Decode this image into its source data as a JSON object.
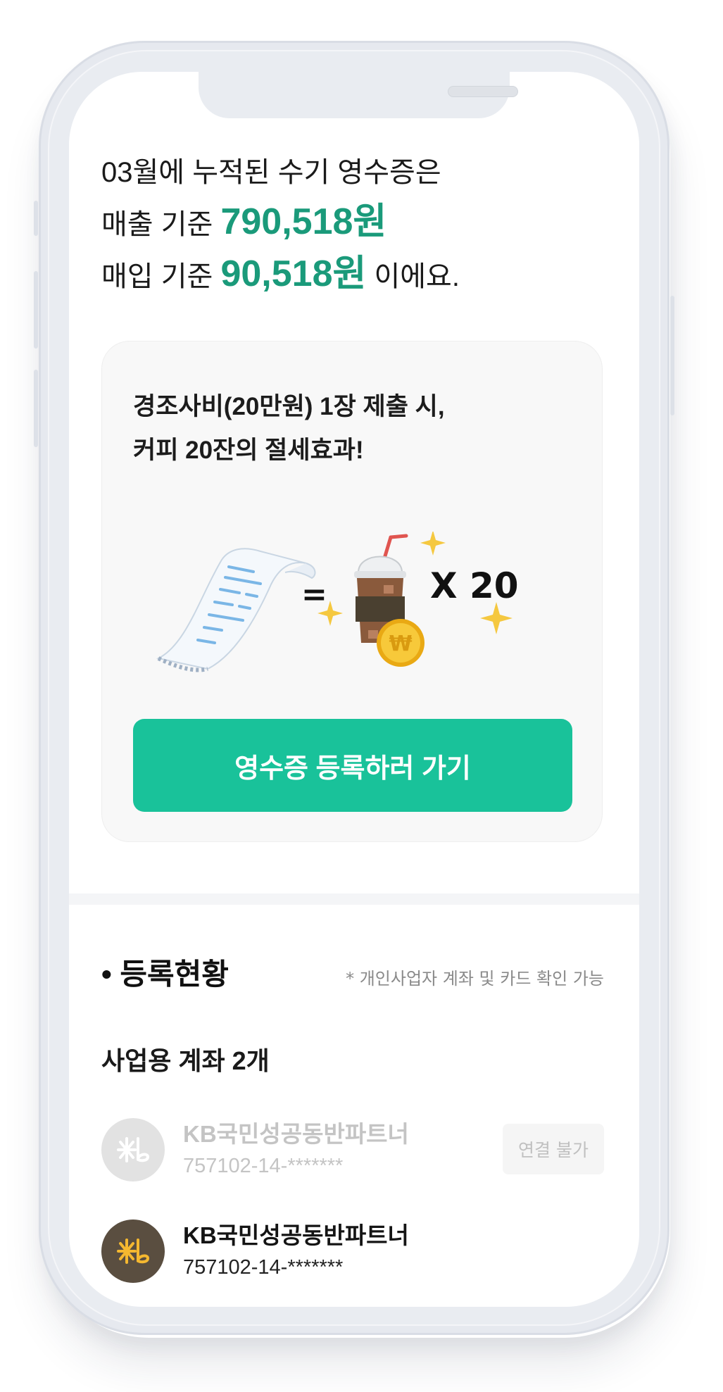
{
  "summary": {
    "line1": "03월에 누적된 수기 영수증은",
    "sales_prefix": "매출 기준 ",
    "sales_amount": "790,518원",
    "purchase_prefix": "매입 기준 ",
    "purchase_amount": "90,518원",
    "purchase_suffix": " 이에요."
  },
  "promo_card": {
    "text_line1": "경조사비(20만원) 1장 제출 시,",
    "text_line2": "커피 20잔의 절세효과!",
    "equals": "=",
    "multiplier": "X  20",
    "icons": [
      "receipt-icon",
      "iced-coffee-icon",
      "won-coin-icon",
      "sparkle-icon"
    ],
    "cta_label": "영수증 등록하러 가기",
    "cta_color": "#19c29a"
  },
  "registration": {
    "title": "• 등록현황",
    "note": "* 개인사업자 계좌 및 카드 확인 가능",
    "accounts_heading": "사업용 계좌 2개",
    "accounts": [
      {
        "bank": "KB국민성공동반파트너",
        "number": "757102-14-*******",
        "status": "연결 불가",
        "disabled": true
      },
      {
        "bank": "KB국민성공동반파트너",
        "number": "757102-14-*******",
        "disabled": false
      }
    ]
  },
  "colors": {
    "accent_green": "#1a9a7a",
    "button_green": "#19c29a",
    "kb_brown": "#5a4e40",
    "kb_yellow": "#f5b830"
  }
}
